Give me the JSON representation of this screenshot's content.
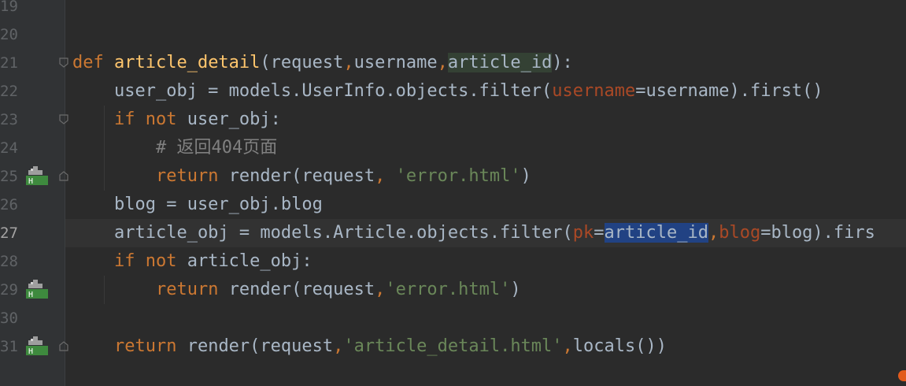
{
  "editor": {
    "lines": [
      {
        "num": "19",
        "segments": []
      },
      {
        "num": "20",
        "segments": []
      },
      {
        "num": "21",
        "segments": [
          {
            "t": "def ",
            "c": "kw"
          },
          {
            "t": "article_detail",
            "c": "fn"
          },
          {
            "t": "(request",
            "c": ""
          },
          {
            "t": ",",
            "c": "comma"
          },
          {
            "t": "username",
            "c": ""
          },
          {
            "t": ",",
            "c": "comma"
          },
          {
            "t": "article_id",
            "c": "hl-param"
          },
          {
            "t": "):",
            "c": ""
          }
        ]
      },
      {
        "num": "22",
        "segments": [
          {
            "t": "    user_obj = models.UserInfo.objects.filter(",
            "c": ""
          },
          {
            "t": "username",
            "c": "param"
          },
          {
            "t": "=username).first()",
            "c": ""
          }
        ]
      },
      {
        "num": "23",
        "segments": [
          {
            "t": "    ",
            "c": ""
          },
          {
            "t": "if not ",
            "c": "kw"
          },
          {
            "t": "user_obj:",
            "c": ""
          }
        ]
      },
      {
        "num": "24",
        "segments": [
          {
            "t": "        ",
            "c": ""
          },
          {
            "t": "# 返回404页面",
            "c": "cmt"
          }
        ]
      },
      {
        "num": "25",
        "segments": [
          {
            "t": "        ",
            "c": ""
          },
          {
            "t": "return ",
            "c": "kw"
          },
          {
            "t": "render(request",
            "c": ""
          },
          {
            "t": ", ",
            "c": "comma"
          },
          {
            "t": "'error.html'",
            "c": "str"
          },
          {
            "t": ")",
            "c": ""
          }
        ]
      },
      {
        "num": "26",
        "segments": [
          {
            "t": "    blog = user_obj.blog",
            "c": ""
          }
        ]
      },
      {
        "num": "27",
        "segments": [
          {
            "t": "    article_obj = models.Article.objects.filter(",
            "c": ""
          },
          {
            "t": "pk",
            "c": "param"
          },
          {
            "t": "=",
            "c": ""
          },
          {
            "t": "article_id",
            "c": "sel"
          },
          {
            "t": ",",
            "c": "comma"
          },
          {
            "t": "blog",
            "c": "param"
          },
          {
            "t": "=blog).firs",
            "c": ""
          }
        ]
      },
      {
        "num": "28",
        "segments": [
          {
            "t": "    ",
            "c": ""
          },
          {
            "t": "if not ",
            "c": "kw"
          },
          {
            "t": "article_obj:",
            "c": ""
          }
        ]
      },
      {
        "num": "29",
        "segments": [
          {
            "t": "        ",
            "c": ""
          },
          {
            "t": "return ",
            "c": "kw"
          },
          {
            "t": "render(request",
            "c": ""
          },
          {
            "t": ",",
            "c": "comma"
          },
          {
            "t": "'error.html'",
            "c": "str"
          },
          {
            "t": ")",
            "c": ""
          }
        ]
      },
      {
        "num": "30",
        "segments": []
      },
      {
        "num": "31",
        "segments": [
          {
            "t": "    ",
            "c": ""
          },
          {
            "t": "return ",
            "c": "kw"
          },
          {
            "t": "render(request",
            "c": ""
          },
          {
            "t": ",",
            "c": "comma"
          },
          {
            "t": "'article_detail.html'",
            "c": "str"
          },
          {
            "t": ",",
            "c": "comma"
          },
          {
            "t": "locals())",
            "c": ""
          }
        ]
      }
    ],
    "current_line": "27",
    "implement_marker_lines": [
      "25",
      "29",
      "31"
    ],
    "fold_marker_lines": [
      "21",
      "23",
      "25",
      "31"
    ],
    "colors": {
      "background": "#2b2b2b",
      "keyword": "#cc7832",
      "function": "#ffc66d",
      "string": "#6a8759",
      "named_param": "#aa4926",
      "comment": "#808080",
      "selection": "#214283"
    }
  }
}
